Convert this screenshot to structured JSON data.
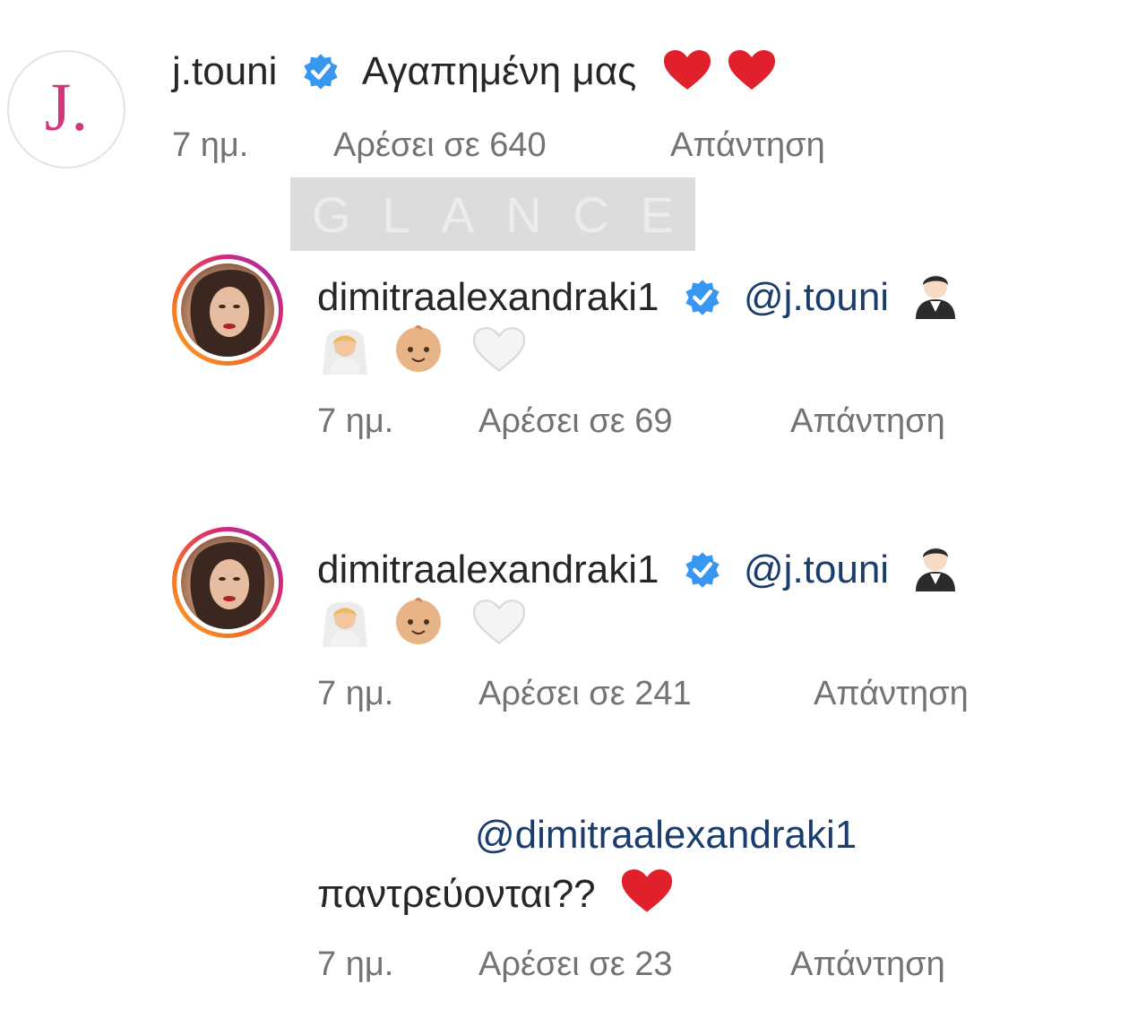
{
  "comments": [
    {
      "username": "j.touni",
      "avatar_letter": "J.",
      "verified": true,
      "text": "Αγαπημένη μας",
      "emojis": [
        "red-heart",
        "red-heart"
      ],
      "time": "7 ημ.",
      "likes": "Αρέσει σε 640",
      "reply": "Απάντηση"
    },
    {
      "username": "dimitraalexandraki1",
      "verified": true,
      "mention": "@j.touni",
      "emojis": [
        "man-in-tuxedo",
        "bride-with-veil",
        "baby",
        "white-heart"
      ],
      "time": "7 ημ.",
      "likes": "Αρέσει σε 69",
      "reply": "Απάντηση"
    },
    {
      "username": "dimitraalexandraki1",
      "verified": true,
      "mention": "@j.touni",
      "emojis": [
        "man-in-tuxedo",
        "bride-with-veil",
        "baby",
        "white-heart"
      ],
      "time": "7 ημ.",
      "likes": "Αρέσει σε 241",
      "reply": "Απάντηση"
    },
    {
      "mention": "@dimitraalexandraki1",
      "text": "παντρεύονται??",
      "emojis": [
        "red-heart"
      ],
      "time": "7 ημ.",
      "likes": "Αρέσει σε 23",
      "reply": "Απάντηση"
    }
  ],
  "watermark": {
    "letters": [
      "G",
      "L",
      "A",
      "N",
      "C",
      "E"
    ]
  },
  "colors": {
    "username": "#262626",
    "mention": "#1b3d6e",
    "meta": "#737373",
    "verified": "#3897f0",
    "heart": "#e0202a",
    "logo": "#d2367f"
  }
}
